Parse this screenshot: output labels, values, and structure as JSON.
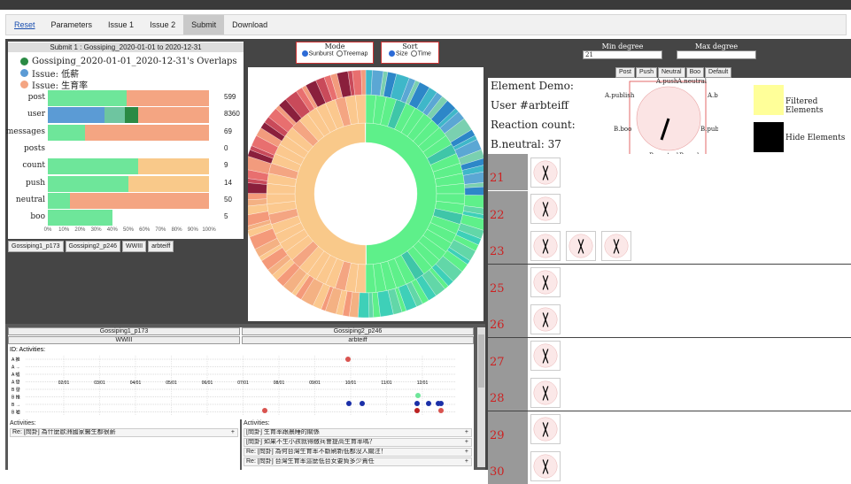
{
  "nav": {
    "tabs": [
      "Reset",
      "Parameters",
      "Issue 1",
      "Issue 2",
      "Submit",
      "Download"
    ],
    "active": "Submit"
  },
  "summary": {
    "title": "Submit 1 : Gossiping_2020-01-01 to 2020-12-31",
    "legend": [
      "Gossiping_2020-01-01_2020-12-31's Overlaps",
      "Issue: 低薪",
      "Issue: 生育率"
    ],
    "legend_colors": [
      "#2a8a44",
      "#5b9bd5",
      "#f4a582"
    ],
    "rows": [
      {
        "label": "post",
        "value": "599",
        "segs": [
          [
            "#6ee69a",
            49
          ],
          [
            "#f4a582",
            51
          ]
        ]
      },
      {
        "label": "user",
        "value": "8360",
        "segs": [
          [
            "#5b9bd5",
            35
          ],
          [
            "#6ec5a0",
            13
          ],
          [
            "#2a8a44",
            8
          ],
          [
            "#f4a582",
            44
          ]
        ]
      },
      {
        "label": "messages",
        "value": "69",
        "segs": [
          [
            "#6ee69a",
            23
          ],
          [
            "#f4a582",
            77
          ]
        ]
      },
      {
        "label": "posts",
        "value": "0",
        "segs": []
      },
      {
        "label": "count",
        "value": "9",
        "segs": [
          [
            "#6ee69a",
            56
          ],
          [
            "#f9c98a",
            44
          ]
        ]
      },
      {
        "label": "push",
        "value": "14",
        "segs": [
          [
            "#6ee69a",
            50
          ],
          [
            "#f9c98a",
            50
          ]
        ]
      },
      {
        "label": "neutral",
        "value": "50",
        "segs": [
          [
            "#6ee69a",
            14
          ],
          [
            "#f4a582",
            86
          ]
        ]
      },
      {
        "label": "boo",
        "value": "5",
        "segs": [
          [
            "#6ee69a",
            40
          ],
          [
            "#fff",
            60
          ]
        ]
      }
    ],
    "x_ticks": [
      "0%",
      "10%",
      "20%",
      "30%",
      "40%",
      "50%",
      "60%",
      "70%",
      "80%",
      "90%",
      "100%"
    ],
    "tags": [
      "Gossiping1_p173",
      "Gossiping2_p246",
      "WWIII",
      "arbteiff"
    ]
  },
  "controls": {
    "mode_title": "Mode",
    "mode_opts": [
      "Sunburst",
      "Treemap"
    ],
    "mode_selected": "Sunburst",
    "sort_title": "Sort",
    "sort_opts": [
      "Size",
      "Time"
    ],
    "sort_selected": "Size"
  },
  "degree": {
    "min_label": "Min degree",
    "min_value": "21",
    "max_label": "Max degree",
    "max_value": "",
    "buttons": [
      "Post",
      "Push",
      "Neutral",
      "Boo",
      "Default"
    ]
  },
  "demo": {
    "title": "Element Demo:",
    "user": "User #arbteiff",
    "reaction_label": "Reaction count:",
    "reaction_value": "B.neutral: 37",
    "radial_labels": [
      "A.push",
      "A.neutral",
      "A.publish",
      "A.boo",
      "B.boo",
      "B.publish",
      "B.neutral",
      "B.push"
    ],
    "filtered_label": "Filtered Elements",
    "hide_label": "Hide Elements",
    "filtered_color": "#ffff99",
    "hide_color": "#000000"
  },
  "degree_rows": [
    {
      "n": "21",
      "count": 1
    },
    {
      "n": "22",
      "count": 1
    },
    {
      "n": "23",
      "count": 3
    },
    {
      "n": "25",
      "count": 1
    },
    {
      "n": "26",
      "count": 1
    },
    {
      "n": "27",
      "count": 1
    },
    {
      "n": "28",
      "count": 1
    },
    {
      "n": "29",
      "count": 1
    },
    {
      "n": "30",
      "count": 1
    }
  ],
  "activities": {
    "heads": [
      "Gossiping1_p173",
      "Gossiping2_p246",
      "WWIII",
      "arbteiff"
    ],
    "id_label": "ID: Activities:",
    "row_labels": [
      "A 推",
      "A →",
      "A 噓",
      "A 發",
      "B 發",
      "B 推",
      "B →",
      "B 噓"
    ],
    "dates": [
      "02/01",
      "03/01",
      "04/01",
      "05/01",
      "06/01",
      "07/01",
      "08/01",
      "09/01",
      "10/01",
      "11/01",
      "12/01"
    ],
    "left_title": "Activities:",
    "left_items": [
      "Re: [問卦] 為什麼歐洲國家醫生都很薪"
    ],
    "right_title": "Activities:",
    "right_items": [
      "[問卦] 生育率跟晨睡的關係",
      "[問卦] 如果不生小孩就得繳兵會提高生育率嗎？",
      "Re: [問卦] 為何台灣生育率不斷刷新低都沒人關注！",
      "Re: [問卦] 台灣生育率這麼低台女要負多少責任"
    ]
  }
}
